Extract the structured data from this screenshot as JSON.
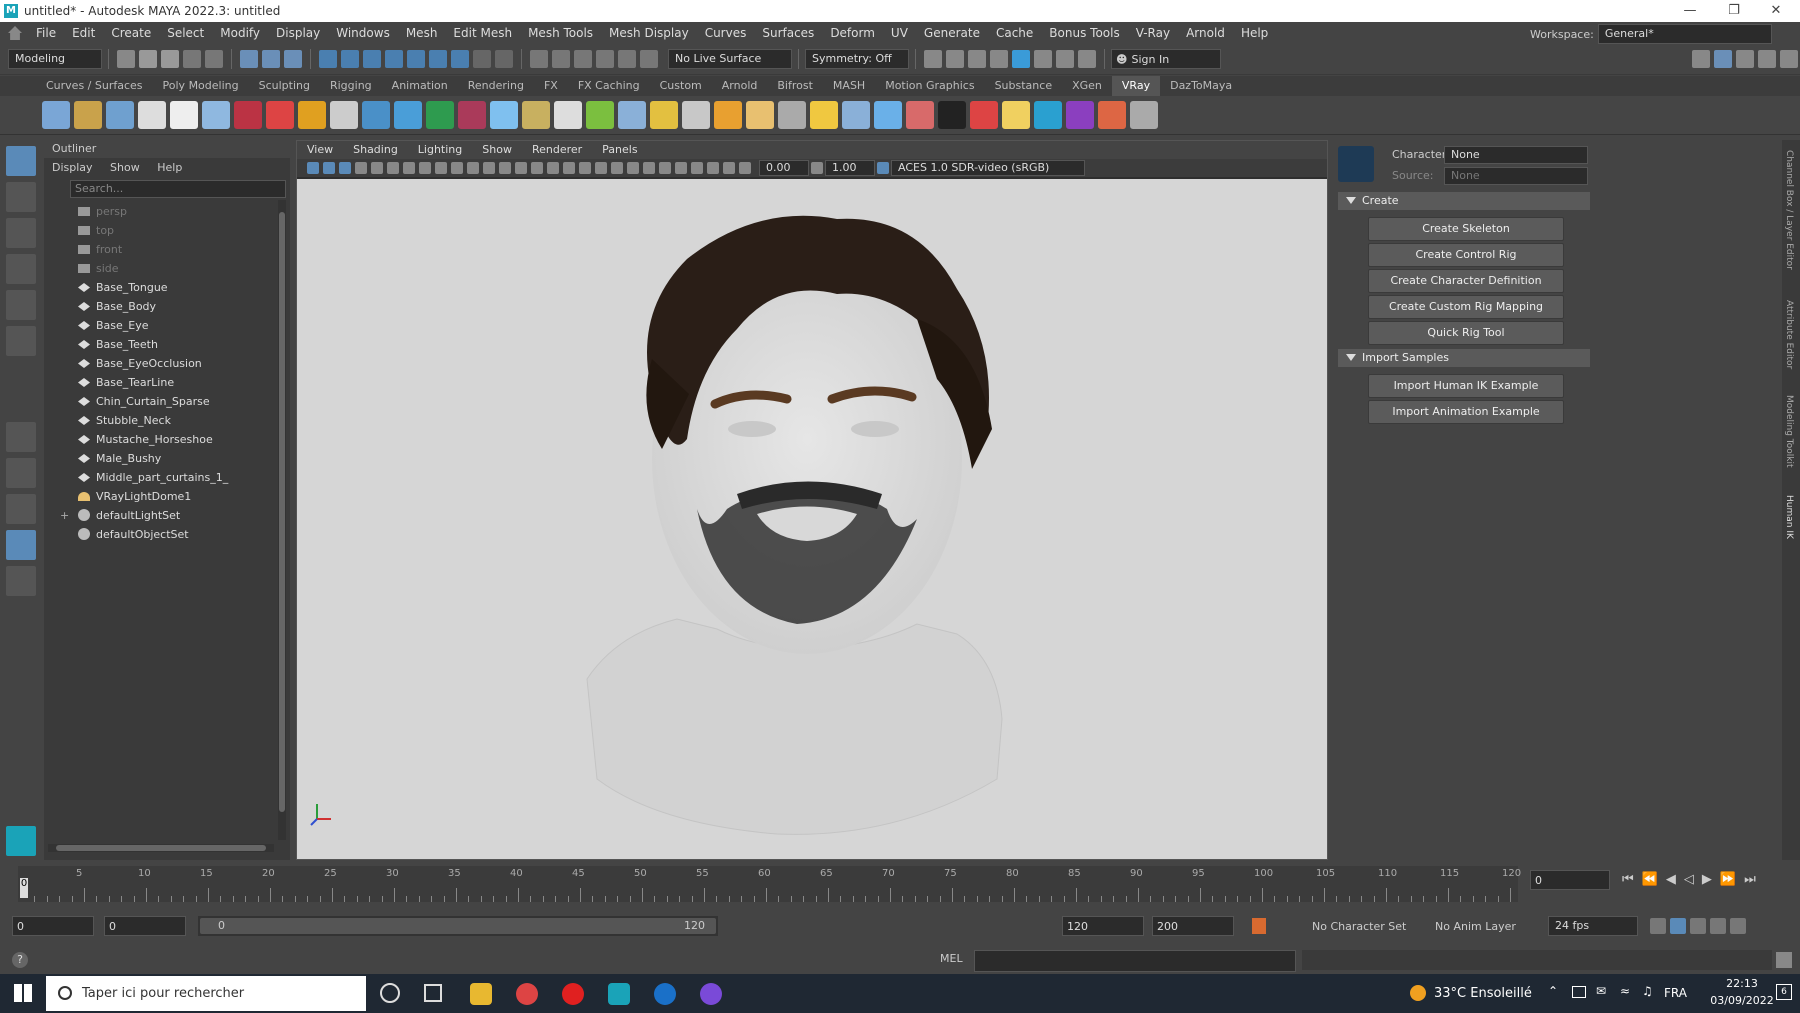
{
  "window": {
    "title": "untitled* - Autodesk MAYA 2022.3: untitled",
    "logo": "M"
  },
  "menubar": {
    "items": [
      "File",
      "Edit",
      "Create",
      "Select",
      "Modify",
      "Display",
      "Windows",
      "Mesh",
      "Edit Mesh",
      "Mesh Tools",
      "Mesh Display",
      "Curves",
      "Surfaces",
      "Deform",
      "UV",
      "Generate",
      "Cache",
      "Bonus Tools",
      "V-Ray",
      "Arnold",
      "Help"
    ],
    "workspace_label": "Workspace:",
    "workspace_value": "General*"
  },
  "statusline": {
    "mode": "Modeling",
    "live_surface": "No Live Surface",
    "symmetry": "Symmetry: Off",
    "sign_in": "Sign In"
  },
  "shelf": {
    "tabs": [
      "Curves / Surfaces",
      "Poly Modeling",
      "Sculpting",
      "Rigging",
      "Animation",
      "Rendering",
      "FX",
      "FX Caching",
      "Custom",
      "Arnold",
      "Bifrost",
      "MASH",
      "Motion Graphics",
      "Substance",
      "XGen",
      "VRay",
      "DazToMaya"
    ],
    "active_tab": "VRay",
    "icon_colors": [
      "#7aa6d6",
      "#c9a24b",
      "#6fa0cf",
      "#ddd",
      "#eee",
      "#8fb8e0",
      "#b34",
      "#d44",
      "#e0a020",
      "#ccc",
      "#4a90c8",
      "#4a9ed8",
      "#2e9b4f",
      "#aa3a5a",
      "#7fc0ef",
      "#c8b060",
      "#ddd",
      "#7bbf3f",
      "#8ab0d8",
      "#e3c040",
      "#c8c8c8",
      "#e8a030",
      "#e8c070",
      "#aaa",
      "#f0c840",
      "#8ab0d8",
      "#6ab0e8",
      "#d86a6a",
      "#222",
      "#d44",
      "#f0d060",
      "#2aa0d0",
      "#8b3fbf",
      "#d64",
      "#aaa"
    ]
  },
  "outliner": {
    "title": "Outliner",
    "menus": [
      "Display",
      "Show",
      "Help"
    ],
    "search_placeholder": "Search...",
    "items": [
      {
        "label": "persp",
        "icon": "camera-icon",
        "dim": true
      },
      {
        "label": "top",
        "icon": "camera-icon",
        "dim": true
      },
      {
        "label": "front",
        "icon": "camera-icon",
        "dim": true
      },
      {
        "label": "side",
        "icon": "camera-icon",
        "dim": true
      },
      {
        "label": "Base_Tongue",
        "icon": "transform-icon",
        "dim": false
      },
      {
        "label": "Base_Body",
        "icon": "transform-icon",
        "dim": false
      },
      {
        "label": "Base_Eye",
        "icon": "transform-icon",
        "dim": false
      },
      {
        "label": "Base_Teeth",
        "icon": "transform-icon",
        "dim": false
      },
      {
        "label": "Base_EyeOcclusion",
        "icon": "transform-icon",
        "dim": false
      },
      {
        "label": "Base_TearLine",
        "icon": "transform-icon",
        "dim": false
      },
      {
        "label": "Chin_Curtain_Sparse",
        "icon": "transform-icon",
        "dim": false
      },
      {
        "label": "Stubble_Neck",
        "icon": "transform-icon",
        "dim": false
      },
      {
        "label": "Mustache_Horseshoe",
        "icon": "transform-icon",
        "dim": false
      },
      {
        "label": "Male_Bushy",
        "icon": "transform-icon",
        "dim": false
      },
      {
        "label": "Middle_part_curtains_1_",
        "icon": "transform-icon",
        "dim": false
      },
      {
        "label": "VRayLightDome1",
        "icon": "dome-light-icon",
        "dim": false
      },
      {
        "label": "defaultLightSet",
        "icon": "set-icon",
        "dim": false
      },
      {
        "label": "defaultObjectSet",
        "icon": "set-icon",
        "dim": false
      }
    ]
  },
  "viewport": {
    "menus": [
      "View",
      "Shading",
      "Lighting",
      "Show",
      "Renderer",
      "Panels"
    ],
    "exposure": "0.00",
    "gamma": "1.00",
    "color_space": "ACES 1.0 SDR-video (sRGB)"
  },
  "hik": {
    "character_label": "Character:",
    "character_value": "None",
    "source_label": "Source:",
    "source_value": "None",
    "create_section": "Create",
    "create_buttons": [
      "Create Skeleton",
      "Create Control Rig",
      "Create Character Definition",
      "Create Custom Rig Mapping",
      "Quick Rig Tool"
    ],
    "import_section": "Import Samples",
    "import_buttons": [
      "Import Human IK Example",
      "Import Animation Example"
    ],
    "side_tabs": [
      "Channel Box / Layer Editor",
      "Attribute Editor",
      "Modeling Toolkit",
      "Human IK"
    ]
  },
  "timeline": {
    "ticks": [
      "5",
      "10",
      "15",
      "20",
      "25",
      "30",
      "35",
      "40",
      "45",
      "50",
      "55",
      "60",
      "65",
      "70",
      "75",
      "80",
      "85",
      "90",
      "95",
      "100",
      "105",
      "110",
      "115",
      "120"
    ],
    "current_frame_left": "0",
    "current_frame": "0"
  },
  "range": {
    "start": "0",
    "playback_start": "0",
    "slider_start": "0",
    "slider_end": "120",
    "playback_end": "120",
    "end": "200",
    "character_set": "No Character Set",
    "anim_layer": "No Anim Layer",
    "fps": "24 fps"
  },
  "cmdline": {
    "lang": "MEL"
  },
  "taskbar": {
    "search_text": "Taper ici pour rechercher",
    "weather": "33°C  Ensoleillé",
    "lang": "FRA",
    "time": "22:13",
    "date": "03/09/2022",
    "notif": "6"
  }
}
